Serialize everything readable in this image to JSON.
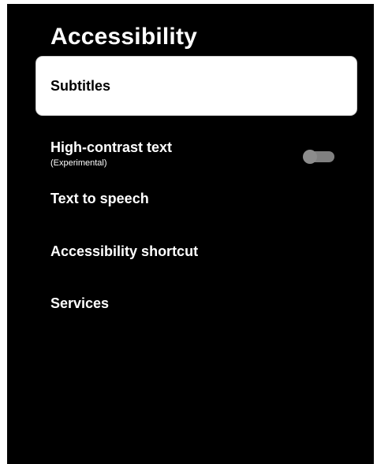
{
  "page": {
    "title": "Accessibility"
  },
  "menu": {
    "items": [
      {
        "label": "Subtitles",
        "selected": true
      },
      {
        "label": "High-contrast text",
        "sublabel": "(Experimental)",
        "toggle": {
          "on": false
        }
      },
      {
        "label": "Text to speech"
      },
      {
        "label": "Accessibility shortcut"
      },
      {
        "label": "Services"
      }
    ]
  },
  "colors": {
    "background": "#000000",
    "selected_background": "#ffffff",
    "text": "#ffffff",
    "selected_text": "#000000",
    "toggle_off": "#808080"
  }
}
